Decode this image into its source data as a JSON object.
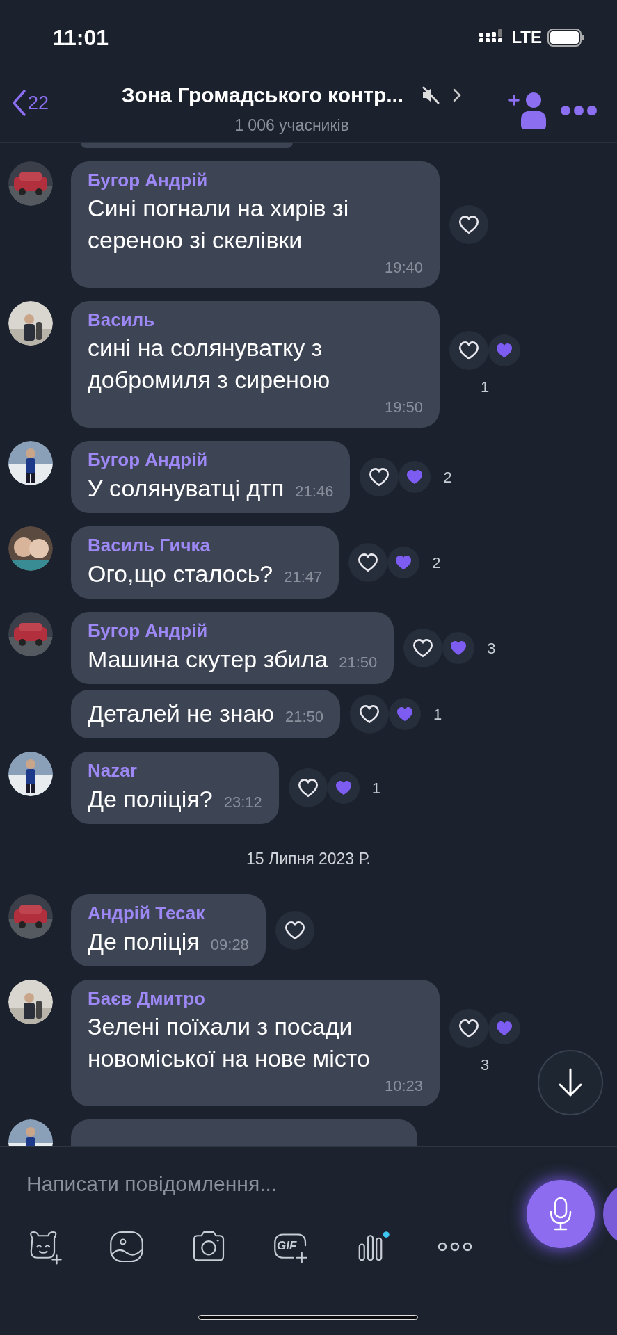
{
  "status_bar": {
    "time": "11:01",
    "network": "LTE"
  },
  "header": {
    "back_count": "22",
    "title": "Зона Громадського контр...",
    "subtitle": "1 006 учасників",
    "muted": true
  },
  "messages": [
    {
      "kind": "multiline",
      "sender": "Бугор Андрій",
      "text": "Сині погнали на хирів зі сереною зі скелівки",
      "time": "19:40",
      "reactions": {
        "liked": false
      }
    },
    {
      "kind": "multiline",
      "sender": "Василь",
      "text": "сині на солянуватку з добромиля  з сиреною",
      "time": "19:50",
      "reactions": {
        "liked": false,
        "others": true,
        "count": "1"
      }
    },
    {
      "kind": "single",
      "sender": "Бугор Андрій",
      "text": "У солянуватці дтп",
      "time": "21:46",
      "reactions": {
        "liked": false,
        "others": true,
        "count": "2"
      }
    },
    {
      "kind": "single",
      "sender": "Василь Гичка",
      "text": "Ого,що сталось?",
      "time": "21:47",
      "reactions": {
        "liked": false,
        "others": true,
        "count": "2"
      }
    },
    {
      "kind": "single",
      "sender": "Бугор Андрій",
      "text": "Машина скутер збила",
      "time": "21:50",
      "reactions": {
        "liked": false,
        "others": true,
        "count": "3"
      }
    },
    {
      "kind": "single",
      "text": "Деталей не знаю",
      "time": "21:50",
      "reactions": {
        "liked": false,
        "others": true,
        "count": "1"
      }
    },
    {
      "kind": "single",
      "sender": "Nazar",
      "text": "Де поліція?",
      "time": "23:12",
      "reactions": {
        "liked": false,
        "others": true,
        "count": "1"
      }
    },
    {
      "kind": "date",
      "text": "15 Липня 2023 Р."
    },
    {
      "kind": "single",
      "sender": "Андрій Тесак",
      "text": "Де поліція",
      "time": "09:28",
      "reactions": {
        "liked": false
      }
    },
    {
      "kind": "multiline",
      "sender": "Баєв Дмитро",
      "text": "Зелені поїхали з посади новоміської на нове місто",
      "time": "10:23",
      "reactions": {
        "liked": false,
        "others": true,
        "count": "3"
      }
    },
    {
      "kind": "partial"
    }
  ],
  "composer": {
    "placeholder": "Написати повідомлення...",
    "tools": [
      {
        "kind": "sticker"
      },
      {
        "kind": "gallery"
      },
      {
        "kind": "camera"
      },
      {
        "kind": "gif",
        "label": "GIF"
      },
      {
        "kind": "audio",
        "badge": true
      },
      {
        "kind": "more"
      }
    ]
  }
}
